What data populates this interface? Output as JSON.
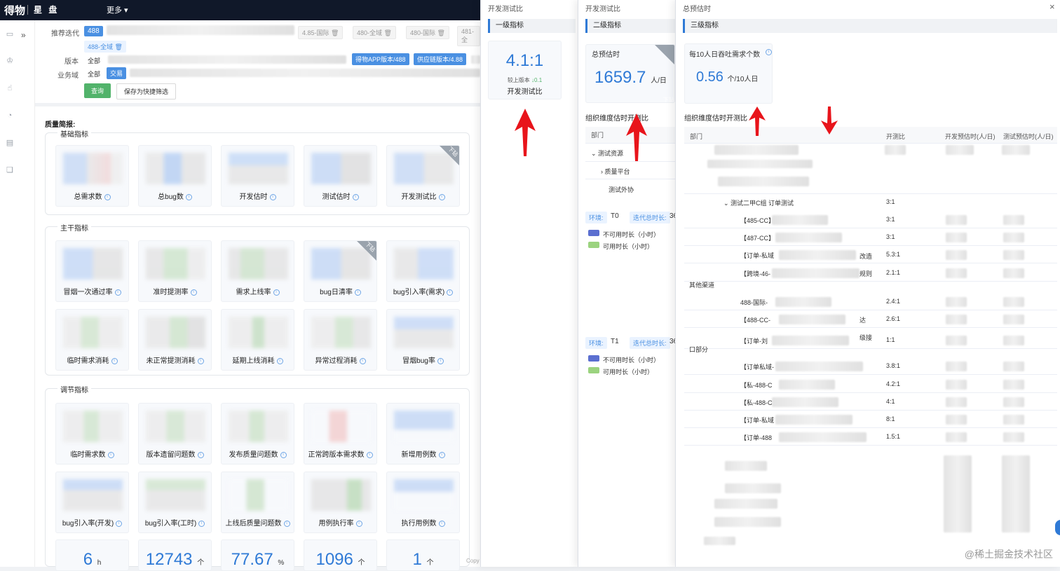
{
  "topbar": {
    "logo": "得物",
    "app_name": "星 盘",
    "more": "更多 ▾"
  },
  "filter": {
    "iteration_label": "推荐迭代",
    "iteration_value": "488",
    "iteration_tags": [
      "4.85-国际",
      "480-全域",
      "480-国际",
      "481-全"
    ],
    "iteration_sub_tag": "488-全域",
    "version_label": "版本",
    "version_all": "全部",
    "version_tags": [
      "得物APP版本/488",
      "供应链版本/4.88"
    ],
    "biz_label": "业务域",
    "biz_all": "全部",
    "biz_selected": "交易",
    "query_button": "查询",
    "save_button": "保存为快捷筛选"
  },
  "main": {
    "title": "质量简报:",
    "groups": [
      {
        "title": "基础指标",
        "cards": [
          "总需求数",
          "总bug数",
          "开发估时",
          "测试估时",
          "开发测试比"
        ]
      },
      {
        "title": "主干指标",
        "cards": [
          "冒烟一次通过率",
          "准时提测率",
          "需求上线率",
          "bug日清率",
          "bug引入率(需求)",
          "临时需求消耗",
          "未正常提测消耗",
          "延期上线消耗",
          "异常过程消耗",
          "冒烟bug率"
        ]
      },
      {
        "title": "调节指标",
        "cards": [
          "临时需求数",
          "版本遗留问题数",
          "发布质量问题数",
          "正常跨版本需求数",
          "新增用例数",
          "bug引入率(开发)",
          "bug引入率(工时)",
          "上线后质量问题数",
          "用例执行率",
          "执行用例数"
        ]
      }
    ],
    "drill_label": "下钻",
    "numbers": [
      {
        "value": "6",
        "unit": "h"
      },
      {
        "value": "12743",
        "unit": "个"
      },
      {
        "value": "77.67",
        "unit": "%"
      },
      {
        "value": "1096",
        "unit": "个"
      },
      {
        "value": "1",
        "unit": "个"
      }
    ]
  },
  "drawer1": {
    "title": "开发测试比",
    "level": "一级指标",
    "ratio": "4.1:1",
    "compare": "较上版本",
    "delta": "↓0.1",
    "kpi_label": "开发测试比"
  },
  "drawer2": {
    "title": "开发测试比",
    "level": "二级指标",
    "kpi_label": "总预估时",
    "value": "1659.7",
    "unit": "人/日",
    "drill": "下钻",
    "table_title": "组织维度估时开测比",
    "col_dept": "部门",
    "rows": [
      "测试资源",
      "质量平台",
      "测试外协"
    ],
    "env1_label": "环境:",
    "env1_value": "T0",
    "env_total": "迭代总时长:",
    "env_total_val": "36",
    "env2_value": "T1",
    "legend_unavailable": "不可用时长（小时）",
    "legend_available": "可用时长（小时）"
  },
  "drawer3": {
    "title": "总预估时",
    "level": "三级指标",
    "kpi_label": "每10人日吞吐需求个数",
    "value": "0.56",
    "unit": "个/10人日",
    "table_title": "组织维度估时开测比",
    "cols": [
      "部门",
      "开测比",
      "开发预估时(人/日)",
      "测试预估时(人/日)"
    ],
    "group_row": "测试二甲C组 订单测试",
    "group_ratio": "3:1",
    "rows": [
      {
        "dept": "【485-CC】",
        "ratio": "3:1"
      },
      {
        "dept": "【487-CC】",
        "ratio": "3:1"
      },
      {
        "dept": "【订单-私域",
        "ratio": "5.3:1"
      },
      {
        "dept": "【跨境-46-",
        "ratio": "2.1:1"
      },
      {
        "dept": "488-国际-",
        "ratio": "2.4:1"
      },
      {
        "dept": "【488-CC-",
        "ratio": "2.6:1"
      },
      {
        "dept": "【订单-刘",
        "ratio": "1:1"
      },
      {
        "dept": "【订单私域-",
        "ratio": "3.8:1"
      },
      {
        "dept": "【私-488-C",
        "ratio": "4.2:1"
      },
      {
        "dept": "【私-488-C",
        "ratio": "4:1"
      },
      {
        "dept": "【订单-私域",
        "ratio": "8:1"
      },
      {
        "dept": "【订单-488",
        "ratio": "1.5:1"
      }
    ],
    "side_label_1": "其他渠道",
    "side_label_2": "口部分",
    "suffix_1": "改造",
    "suffix_2": "规则",
    "suffix_3": "达",
    "suffix_4": "级接"
  },
  "watermark": "@稀土掘金技术社区",
  "copy": "Copy"
}
